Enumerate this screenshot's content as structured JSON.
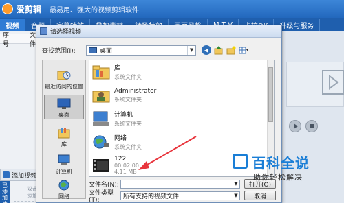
{
  "app": {
    "name": "爱剪辑",
    "slogan": "最易用、强大的视频剪辑软件",
    "tabs": [
      "视频",
      "音频",
      "字幕特效",
      "叠加素材",
      "转场特效",
      "画面风格",
      "M T V",
      "卡拉OK",
      "升级与服务"
    ],
    "column_headers": [
      "序号",
      "文件"
    ],
    "add_video_label": "添加视频",
    "side_tab_label": "已添加片段",
    "hint_text": "双击添加"
  },
  "dialog": {
    "title": "请选择视频",
    "look_in_label": "查找范围(I):",
    "look_in_value": "桌面",
    "places": [
      {
        "label": "最近访问的位置",
        "icon": "recent-places-icon"
      },
      {
        "label": "桌面",
        "icon": "desktop-icon",
        "selected": true
      },
      {
        "label": "库",
        "icon": "libraries-icon"
      },
      {
        "label": "计算机",
        "icon": "computer-icon"
      },
      {
        "label": "网络",
        "icon": "network-icon"
      }
    ],
    "items": [
      {
        "name": "库",
        "type": "系统文件夹",
        "icon": "libraries-folder-icon"
      },
      {
        "name": "Administrator",
        "type": "系统文件夹",
        "icon": "user-folder-icon"
      },
      {
        "name": "计算机",
        "type": "系统文件夹",
        "icon": "computer-icon"
      },
      {
        "name": "网络",
        "type": "系统文件夹",
        "icon": "network-icon"
      },
      {
        "name": "122",
        "duration": "00:02:00",
        "size": "4.11 MB",
        "icon": "video-file-icon"
      }
    ],
    "filename_label": "文件名(N):",
    "filename_value": "",
    "filetype_label": "文件类型(T):",
    "filetype_value": "所有支持的视频文件",
    "open_button": "打开(O)",
    "cancel_button": "取消"
  },
  "watermark": {
    "title": "百科全说",
    "subtitle": "助你轻松解决"
  },
  "colors": {
    "app_blue": "#2368bd",
    "annotation_arrow": "#e8343c",
    "watermark_blue": "#1a7ed6"
  }
}
